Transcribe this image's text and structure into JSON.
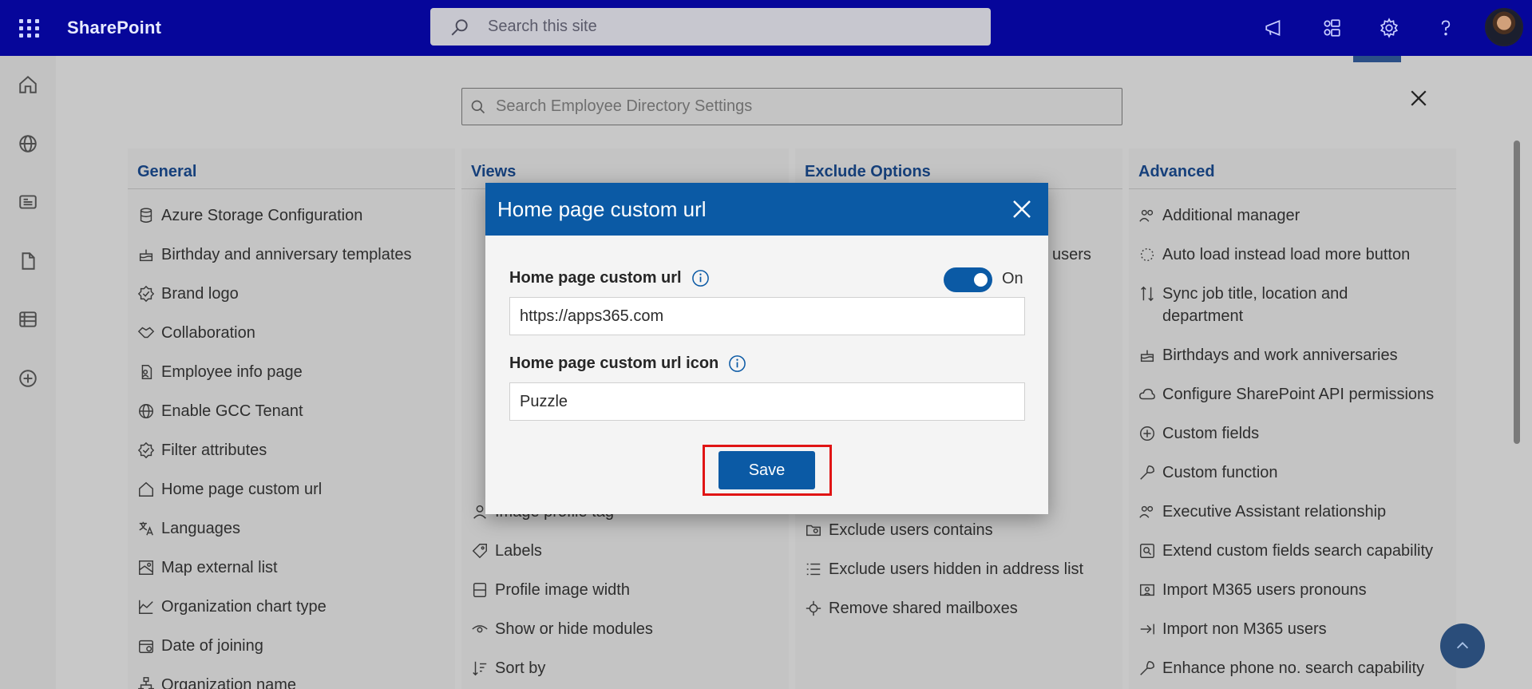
{
  "suitebar": {
    "brand": "SharePoint",
    "search_placeholder": "Search this site"
  },
  "settings": {
    "search_placeholder": "Search Employee Directory Settings",
    "columns": [
      {
        "heading": "General",
        "items": [
          {
            "label": "Azure Storage Configuration",
            "icon": "database-icon"
          },
          {
            "label": "Birthday and anniversary templates",
            "icon": "cake-icon"
          },
          {
            "label": "Brand logo",
            "icon": "badge-icon"
          },
          {
            "label": "Collaboration",
            "icon": "handshake-icon"
          },
          {
            "label": "Employee info page",
            "icon": "person-doc-icon"
          },
          {
            "label": "Enable GCC Tenant",
            "icon": "globe-icon"
          },
          {
            "label": "Filter attributes",
            "icon": "badge-icon"
          },
          {
            "label": "Home page custom url",
            "icon": "home-icon"
          },
          {
            "label": "Languages",
            "icon": "translate-icon"
          },
          {
            "label": "Map external list",
            "icon": "map-icon"
          },
          {
            "label": "Organization chart type",
            "icon": "chart-icon"
          },
          {
            "label": "Date of joining",
            "icon": "calendar-icon"
          },
          {
            "label": "Organization name",
            "icon": "org-icon"
          }
        ]
      },
      {
        "heading": "Views",
        "items": [
          {
            "label": "Image profile tag",
            "icon": "person-icon"
          },
          {
            "label": "Labels",
            "icon": "tag-icon"
          },
          {
            "label": "Profile image width",
            "icon": "image-icon"
          },
          {
            "label": "Show or hide modules",
            "icon": "eye-icon"
          },
          {
            "label": "Sort by",
            "icon": "sort-icon"
          }
        ]
      },
      {
        "heading": "Exclude Options",
        "items": [
          {
            "label": "Exclude users contains",
            "icon": "folder-person-icon"
          },
          {
            "label": "Exclude users hidden in address list",
            "icon": "list-icon"
          },
          {
            "label": "Remove shared mailboxes",
            "icon": "mailbox-icon"
          }
        ],
        "partial_text": "users"
      },
      {
        "heading": "Advanced",
        "items": [
          {
            "label": "Additional manager",
            "icon": "people-icon"
          },
          {
            "label": "Auto load instead load more button",
            "icon": "spinner-icon"
          },
          {
            "label": "Sync job title, location and department",
            "icon": "sync-icon"
          },
          {
            "label": "Birthdays and work anniversaries",
            "icon": "cake-icon"
          },
          {
            "label": "Configure SharePoint API permissions",
            "icon": "cloud-icon"
          },
          {
            "label": "Custom fields",
            "icon": "add-circle-icon"
          },
          {
            "label": "Custom function",
            "icon": "wrench-icon"
          },
          {
            "label": "Executive Assistant relationship",
            "icon": "people-icon"
          },
          {
            "label": "Extend custom fields search capability",
            "icon": "search-box-icon"
          },
          {
            "label": "Import M365 users pronouns",
            "icon": "import-icon"
          },
          {
            "label": "Import non M365 users",
            "icon": "arrow-in-icon"
          },
          {
            "label": "Enhance phone no. search capability",
            "icon": "wrench-icon"
          }
        ]
      }
    ]
  },
  "modal": {
    "title": "Home page custom url",
    "url_label": "Home page custom url",
    "toggle_state": "On",
    "url_value": "https://apps365.com",
    "icon_label": "Home page custom url icon",
    "icon_value": "Puzzle",
    "save_label": "Save"
  },
  "colors": {
    "suitebar": "#06069a",
    "accent": "#0b5aa5",
    "highlight": "#e01414"
  }
}
